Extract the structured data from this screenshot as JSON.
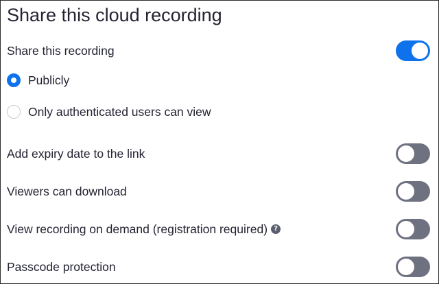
{
  "title": "Share this cloud recording",
  "share_recording": {
    "label": "Share this recording",
    "enabled": true
  },
  "visibility": {
    "options": [
      {
        "label": "Publicly",
        "selected": true
      },
      {
        "label": "Only authenticated users can view",
        "selected": false
      }
    ]
  },
  "settings": [
    {
      "label": "Add expiry date to the link",
      "enabled": false
    },
    {
      "label": "Viewers can download",
      "enabled": false
    },
    {
      "label": "View recording on demand (registration required)",
      "enabled": false,
      "icon": "help-icon",
      "icon_glyph": "?"
    },
    {
      "label": "Passcode protection",
      "enabled": false
    }
  ],
  "colors": {
    "accent": "#0e72ed",
    "toggle_off": "#6e7180",
    "text": "#232333"
  }
}
